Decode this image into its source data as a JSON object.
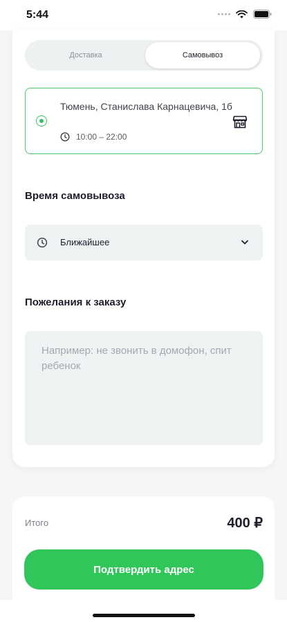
{
  "status_bar": {
    "time": "5:44"
  },
  "tabs": {
    "delivery": "Доставка",
    "pickup": "Самовывоз",
    "active": "pickup"
  },
  "pickup_point": {
    "address": "Тюмень, Станислава Карнацевича, 1б",
    "hours": "10:00 – 22:00",
    "selected": true
  },
  "pickup_time": {
    "title": "Время самовывоза",
    "value": "Ближайшее"
  },
  "comments": {
    "title": "Пожелания к заказу",
    "value": "",
    "placeholder": "Например: не звонить в домофон, спит ребенок"
  },
  "footer": {
    "total_label": "Итого",
    "total_value": "400 ₽",
    "confirm_label": "Подтвердить адрес"
  },
  "colors": {
    "accent": "#31c65a",
    "selected_border": "#51c76d",
    "field_bg": "#eef2f3"
  },
  "icons": [
    "signal-icon",
    "wifi-icon",
    "battery-icon",
    "clock-icon",
    "store-icon",
    "chevron-down-icon"
  ]
}
